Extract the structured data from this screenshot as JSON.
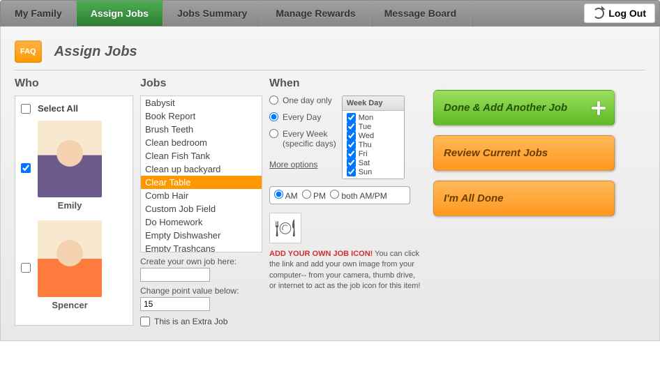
{
  "nav": {
    "items": [
      "My Family",
      "Assign Jobs",
      "Jobs Summary",
      "Manage Rewards",
      "Message Board"
    ],
    "active_index": 1,
    "logout": "Log Out"
  },
  "faq_label": "FAQ",
  "page_title": "Assign Jobs",
  "columns": {
    "who": "Who",
    "jobs": "Jobs",
    "when": "When"
  },
  "who": {
    "select_all": "Select All",
    "kids": [
      {
        "name": "Emily",
        "checked": true
      },
      {
        "name": "Spencer",
        "checked": false
      }
    ]
  },
  "jobs": {
    "list": [
      "Babysit",
      "Book Report",
      "Brush Teeth",
      "Clean bedroom",
      "Clean Fish Tank",
      "Clean up backyard",
      "Clear Table",
      "Comb Hair",
      "Custom Job Field",
      "Do Homework",
      "Empty Dishwasher",
      "Empty Trashcans"
    ],
    "selected": "Clear Table",
    "create_label": "Create your own job here:",
    "create_value": "",
    "points_label": "Change point value below:",
    "points_value": "15",
    "extra_label": "This is an Extra Job"
  },
  "when": {
    "options": {
      "one_day": "One day only",
      "every_day": "Every Day",
      "every_week": "Every Week",
      "every_week_sub": "(specific days)"
    },
    "selected": "every_day",
    "more_options": "More options",
    "weekday_header": "Week Day",
    "weekdays": [
      "Mon",
      "Tue",
      "Wed",
      "Thu",
      "Fri",
      "Sat",
      "Sun"
    ],
    "ampm": {
      "am": "AM",
      "pm": "PM",
      "both": "both AM/PM",
      "selected": "am"
    },
    "icon_hint_red": "ADD YOUR OWN JOB ICON!",
    "icon_hint_rest": " You can click the link and add your own image from your computer-- from your camera, thumb drive, or internet to act as the job icon for this item!"
  },
  "actions": {
    "done_add": "Done & Add Another Job",
    "review": "Review Current Jobs",
    "all_done": "I'm All Done"
  }
}
